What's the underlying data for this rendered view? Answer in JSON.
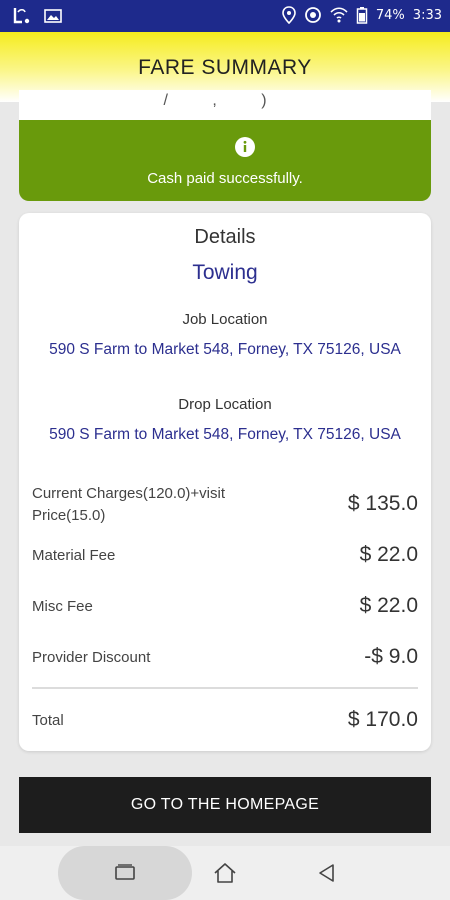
{
  "status_bar": {
    "icons_left": [
      "app-logo-icon",
      "image-icon"
    ],
    "icons_right": [
      "location-icon",
      "hotspot-icon",
      "wifi-icon",
      "battery-icon"
    ],
    "battery": "74%",
    "time": "3:33"
  },
  "header": {
    "title": "FARE SUMMARY"
  },
  "top_card": {
    "clipped_text": "/   ,   )"
  },
  "banner": {
    "icon": "info-icon",
    "message": "Cash paid successfully.",
    "color": "#699a0c"
  },
  "details": {
    "heading": "Details",
    "service": "Towing",
    "job_location_label": "Job Location",
    "job_location": "590 S Farm to Market 548, Forney, TX 75126, USA",
    "drop_location_label": "Drop Location",
    "drop_location": "590 S Farm to Market 548, Forney, TX 75126, USA",
    "charges": [
      {
        "label": "Current Charges(120.0)+visit Price(15.0)",
        "value": "$ 135.0"
      },
      {
        "label": "Material Fee",
        "value": "$ 22.0"
      },
      {
        "label": "Misc Fee",
        "value": "$ 22.0"
      },
      {
        "label": "Provider Discount",
        "value": "-$ 9.0"
      }
    ],
    "total_label": "Total",
    "total_value": "$ 170.0"
  },
  "button": {
    "label": "GO TO THE HOMEPAGE"
  },
  "nav": {
    "icons": [
      "recent-apps-icon",
      "home-icon",
      "back-icon"
    ]
  },
  "colors": {
    "accent_blue": "#2c2f8f",
    "status_bar": "#1e2a8c",
    "header_yellow": "#f5ec1e"
  }
}
